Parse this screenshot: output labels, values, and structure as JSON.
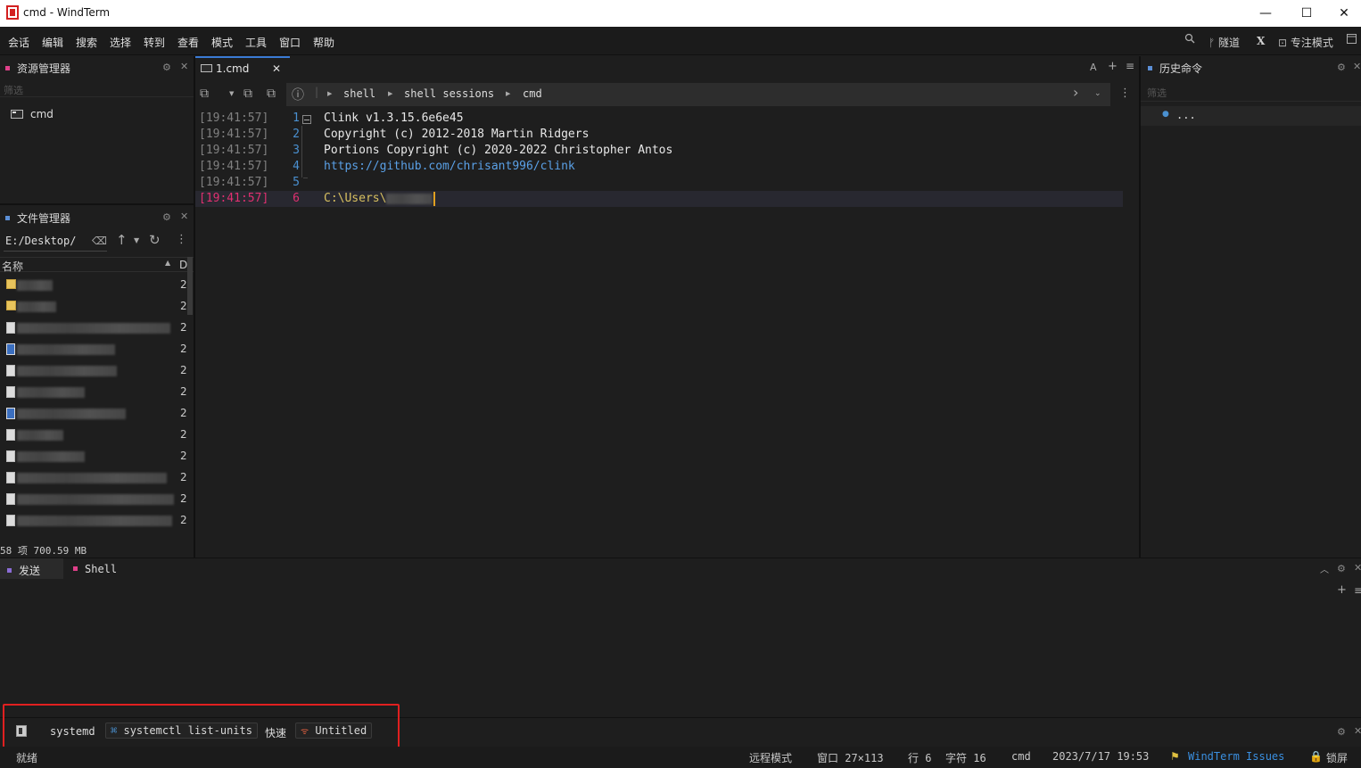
{
  "window": {
    "title": "cmd - WindTerm",
    "minimize": "—",
    "maximize": "☐",
    "close": "✕"
  },
  "menu": {
    "items": [
      "会话",
      "编辑",
      "搜索",
      "选择",
      "转到",
      "查看",
      "模式",
      "工具",
      "窗口",
      "帮助"
    ]
  },
  "menu_right": {
    "search_icon": "search-icon",
    "tunnel": "隧道",
    "x_label": "X",
    "focus_mode": "专注模式"
  },
  "resource_panel": {
    "title": "资源管理器",
    "filter_placeholder": "筛选",
    "items": [
      "cmd"
    ]
  },
  "file_panel": {
    "title": "文件管理器",
    "path": "E:/Desktop/",
    "col_name": "名称",
    "col_date": "D",
    "rows": [
      {
        "icon": "folder",
        "date": "2"
      },
      {
        "icon": "folder",
        "date": "2"
      },
      {
        "icon": "shortcut",
        "date": "2"
      },
      {
        "icon": "image",
        "date": "2"
      },
      {
        "icon": "shortcut",
        "date": "2"
      },
      {
        "icon": "file",
        "date": "2"
      },
      {
        "icon": "image",
        "date": "2"
      },
      {
        "icon": "file",
        "date": "2"
      },
      {
        "icon": "shortcut",
        "date": "2"
      },
      {
        "icon": "file",
        "date": "2"
      },
      {
        "icon": "file",
        "date": "2"
      },
      {
        "icon": "file",
        "date": "2"
      }
    ],
    "summary": "58 项 700.59 MB"
  },
  "editor": {
    "tab_label": "1.cmd",
    "tab_right": [
      "A",
      "+",
      "≡"
    ],
    "breadcrumb": [
      "shell",
      "shell sessions",
      "cmd"
    ],
    "lines": [
      {
        "ts": "[19:41:57]",
        "no": "1",
        "text": "Clink v1.3.15.6e6e45"
      },
      {
        "ts": "[19:41:57]",
        "no": "2",
        "text": "Copyright (c) 2012-2018 Martin Ridgers"
      },
      {
        "ts": "[19:41:57]",
        "no": "3",
        "text": "Portions Copyright (c) 2020-2022 Christopher Antos"
      },
      {
        "ts": "[19:41:57]",
        "no": "4",
        "text": "https://github.com/chrisant996/clink"
      },
      {
        "ts": "[19:41:57]",
        "no": "5",
        "text": ""
      },
      {
        "ts": "[19:41:57]",
        "no": "6",
        "text": "C:\\Users\\"
      }
    ]
  },
  "history_panel": {
    "title": "历史命令",
    "filter_placeholder": "筛选",
    "items": [
      "..."
    ]
  },
  "bottom_tabs": {
    "send": "发送",
    "shell": "Shell"
  },
  "quickbar": {
    "systemd": "systemd",
    "cmd_button": "systemctl list-units",
    "quick": "快速",
    "untitled": "Untitled"
  },
  "status": {
    "ready": "就绪",
    "remote_mode": "远程模式",
    "window_size": "窗口 27×113",
    "row": "行 6",
    "col": "字符 16",
    "shell": "cmd",
    "datetime": "2023/7/17 19:53",
    "issues": "WindTerm Issues",
    "lock": "锁屏"
  },
  "colors": {
    "accent": "#4a90d0",
    "highlight": "#e03070",
    "annotation": "#e02020"
  }
}
